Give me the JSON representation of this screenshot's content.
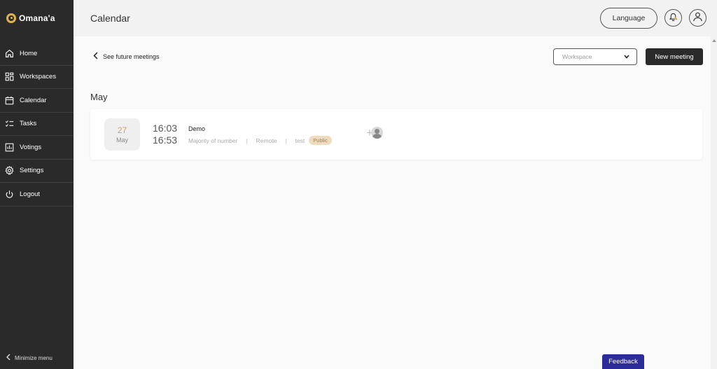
{
  "app": {
    "name": "Omana'a"
  },
  "sidebar": {
    "items": [
      {
        "label": "Home",
        "icon": "home-icon"
      },
      {
        "label": "Workspaces",
        "icon": "workspaces-icon"
      },
      {
        "label": "Calendar",
        "icon": "calendar-icon"
      },
      {
        "label": "Tasks",
        "icon": "tasks-icon"
      },
      {
        "label": "Votings",
        "icon": "votings-icon"
      },
      {
        "label": "Settings",
        "icon": "gear-icon"
      },
      {
        "label": "Logout",
        "icon": "power-icon"
      }
    ],
    "minimize_label": "Minimize menu"
  },
  "header": {
    "title": "Calendar",
    "language_label": "Language"
  },
  "toolbar": {
    "back_label": "See future meetings",
    "workspace_placeholder": "Workspace",
    "new_meeting_label": "New meeting"
  },
  "month_label": "May",
  "meetings": [
    {
      "day": "27",
      "month": "May",
      "start": "16:03",
      "end": "16:53",
      "title": "Demo",
      "voting": "Majority of number",
      "location": "Remote",
      "workspace": "test",
      "visibility": "Public"
    }
  ],
  "feedback_label": "Feedback",
  "colors": {
    "sidebar_bg": "#2a2a2a",
    "accent_gold": "#c6a56a",
    "feedback_bg": "#2d2a9a",
    "badge_bg": "#eddcc0"
  }
}
